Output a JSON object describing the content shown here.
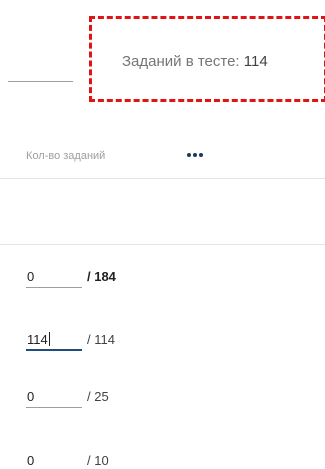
{
  "header": {
    "task_count_label": "Заданий в тесте:",
    "task_count_value": "114",
    "column_label": "Кол-во заданий",
    "more_icon": "more-horizontal-icon"
  },
  "rows": [
    {
      "value": "0",
      "total": "/ 184",
      "active": false
    },
    {
      "value": "114",
      "total": "/ 114",
      "active": true
    },
    {
      "value": "0",
      "total": "/ 25",
      "active": false
    },
    {
      "value": "0",
      "total": "/ 10",
      "active": false
    }
  ],
  "colors": {
    "highlight_border": "#e01414",
    "active_underline": "#1e4f7a",
    "more_icon": "#1a3a5c"
  }
}
